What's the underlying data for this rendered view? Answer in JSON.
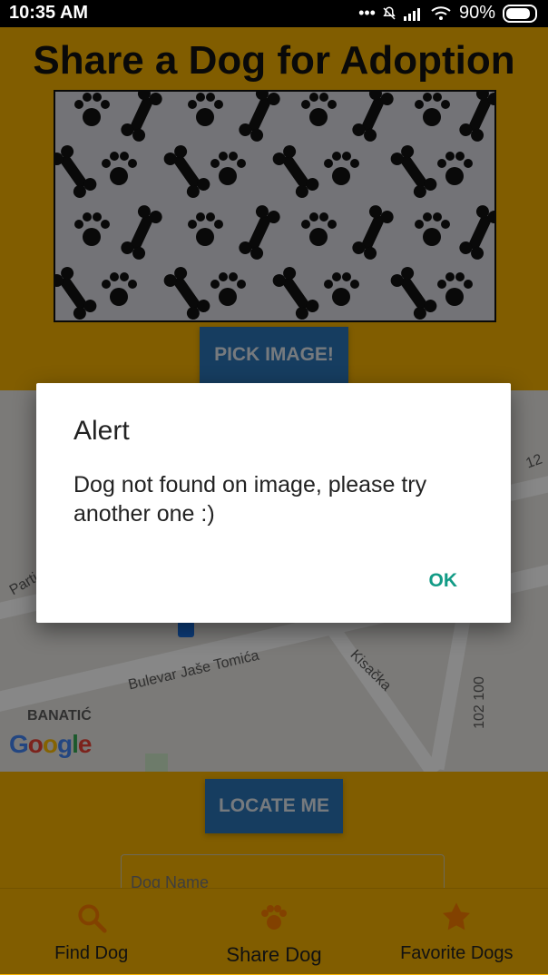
{
  "status_bar": {
    "time": "10:35 AM",
    "icons_text": "... ",
    "battery_percent": "90%"
  },
  "page": {
    "title": "Share a Dog for Adoption"
  },
  "buttons": {
    "pick_image": "PICK IMAGE!",
    "locate_me": "LOCATE ME"
  },
  "form": {
    "dog_name_placeholder": "Dog Name"
  },
  "map": {
    "labels": {
      "bulevar": "Bulevar Jaše Tomića",
      "kisacka": "Kisačka",
      "banatic": "BANATIĆ",
      "numbers": "102 100",
      "parti": "Parti",
      "twelve": "12"
    },
    "logo": {
      "text": "Google"
    }
  },
  "dialog": {
    "title": "Alert",
    "message": "Dog not found on image, please try another one :)",
    "ok_label": "OK"
  },
  "bottom_nav": {
    "items": [
      {
        "label": "Find Dog",
        "icon": "search-icon"
      },
      {
        "label": "Share Dog",
        "icon": "paw-icon"
      },
      {
        "label": "Favorite Dogs",
        "icon": "star-icon"
      }
    ]
  }
}
